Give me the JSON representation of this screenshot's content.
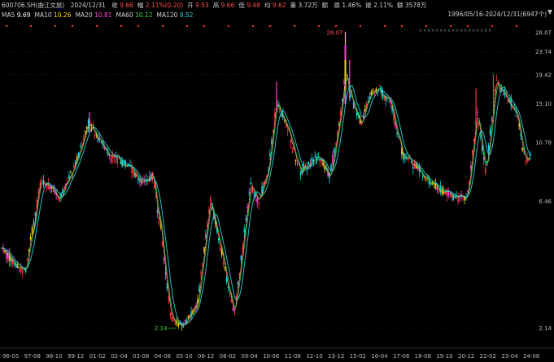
{
  "header": {
    "code_name": "600706.SH(曲江文旅)",
    "date": "2024/12/31",
    "fields": [
      {
        "label": "收",
        "value": "9.66",
        "color": "#ff4d4d"
      },
      {
        "label": "幅",
        "value": "2.11%(0.20)",
        "color": "#ff4d4d"
      },
      {
        "label": "开",
        "value": "9.53",
        "color": "#ff4d4d"
      },
      {
        "label": "高",
        "value": "9.66",
        "color": "#ff4d4d"
      },
      {
        "label": "低",
        "value": "9.48",
        "color": "#ff4d4d"
      },
      {
        "label": "均",
        "value": "9.62",
        "color": "#ff4d4d"
      },
      {
        "label": "量",
        "value": "3.72万",
        "color": "#cfcfcf"
      },
      {
        "label": "额",
        "value": "",
        "color": "#cfcfcf"
      },
      {
        "label": "换",
        "value": "1.46%",
        "color": "#cfcfcf"
      },
      {
        "label": "振",
        "value": "2.11%",
        "color": "#cfcfcf"
      },
      {
        "label": "额",
        "value": "3578万",
        "color": "#cfcfcf"
      }
    ]
  },
  "ma_legend": [
    {
      "label": "MA5",
      "value": "9.69",
      "color": "#ffffff"
    },
    {
      "label": "MA10",
      "value": "10.26",
      "color": "#ffd400"
    },
    {
      "label": "MA20",
      "value": "10.81",
      "color": "#ff44cc"
    },
    {
      "label": "MA60",
      "value": "10.12",
      "color": "#33dd33"
    },
    {
      "label": "MA120",
      "value": "8.52",
      "color": "#33ccdd"
    }
  ],
  "range_text": "1996/05/16-2024/12/31(6947个)",
  "colors": {
    "up": "#ff3333",
    "down": "#00dddd",
    "grid": "#444444",
    "axis_text": "#bbbbbb",
    "yellow": "#ffd400",
    "magenta": "#ff44cc"
  },
  "chart_data": {
    "type": "candlestick",
    "title": "",
    "xlabel": "",
    "ylabel": "",
    "y_scale": "log",
    "ylim": [
      1.9,
      30.0
    ],
    "y_ticks": [
      28.07,
      23.74,
      19.42,
      15.1,
      10.78,
      6.46,
      2.14
    ],
    "y_tick_labels": [
      "28.07",
      "23.74",
      "19.42",
      "15.10",
      "10.78",
      "6.46",
      "2.14"
    ],
    "x_tick_labels": [
      "96-05",
      "97-08",
      "98-10",
      "99-12",
      "01-02",
      "02-04",
      "03-06",
      "04-08",
      "05-10",
      "06-12",
      "08-02",
      "09-04",
      "10-06",
      "11-08",
      "12-10",
      "13-12",
      "15-02",
      "16-04",
      "17-06",
      "18-08",
      "19-10",
      "20-12",
      "22-02",
      "23-04",
      "24-06"
    ],
    "annotations": [
      {
        "text": "28.07",
        "type": "max",
        "value": 28.07
      },
      {
        "text": "2.14",
        "type": "min",
        "value": 2.14
      }
    ],
    "price_path": [
      {
        "t": 0.0,
        "v": 4.2
      },
      {
        "t": 0.02,
        "v": 3.8
      },
      {
        "t": 0.045,
        "v": 3.5
      },
      {
        "t": 0.075,
        "v": 7.8
      },
      {
        "t": 0.11,
        "v": 6.6
      },
      {
        "t": 0.14,
        "v": 9.0
      },
      {
        "t": 0.165,
        "v": 12.8
      },
      {
        "t": 0.185,
        "v": 11.0
      },
      {
        "t": 0.205,
        "v": 9.5
      },
      {
        "t": 0.235,
        "v": 9.0
      },
      {
        "t": 0.265,
        "v": 7.6
      },
      {
        "t": 0.285,
        "v": 8.1
      },
      {
        "t": 0.3,
        "v": 5.2
      },
      {
        "t": 0.32,
        "v": 2.3
      },
      {
        "t": 0.345,
        "v": 2.2
      },
      {
        "t": 0.37,
        "v": 2.6
      },
      {
        "t": 0.395,
        "v": 6.6
      },
      {
        "t": 0.42,
        "v": 3.8
      },
      {
        "t": 0.44,
        "v": 2.4
      },
      {
        "t": 0.47,
        "v": 7.5
      },
      {
        "t": 0.485,
        "v": 6.4
      },
      {
        "t": 0.505,
        "v": 8.5
      },
      {
        "t": 0.52,
        "v": 15.4
      },
      {
        "t": 0.545,
        "v": 11.3
      },
      {
        "t": 0.565,
        "v": 8.3
      },
      {
        "t": 0.6,
        "v": 9.5
      },
      {
        "t": 0.62,
        "v": 8.0
      },
      {
        "t": 0.64,
        "v": 13.0
      },
      {
        "t": 0.65,
        "v": 20.0
      },
      {
        "t": 0.66,
        "v": 16.0
      },
      {
        "t": 0.68,
        "v": 13.0
      },
      {
        "t": 0.7,
        "v": 16.5
      },
      {
        "t": 0.715,
        "v": 17.0
      },
      {
        "t": 0.735,
        "v": 15.2
      },
      {
        "t": 0.76,
        "v": 9.5
      },
      {
        "t": 0.79,
        "v": 8.5
      },
      {
        "t": 0.82,
        "v": 7.2
      },
      {
        "t": 0.85,
        "v": 6.8
      },
      {
        "t": 0.88,
        "v": 6.5
      },
      {
        "t": 0.9,
        "v": 14.0
      },
      {
        "t": 0.915,
        "v": 8.2
      },
      {
        "t": 0.935,
        "v": 18.5
      },
      {
        "t": 0.955,
        "v": 16.0
      },
      {
        "t": 0.975,
        "v": 14.0
      },
      {
        "t": 0.99,
        "v": 9.0
      },
      {
        "t": 1.0,
        "v": 9.66
      }
    ],
    "spikes": [
      {
        "t": 0.65,
        "v": 28.07
      },
      {
        "t": 0.658,
        "v": 22.0
      },
      {
        "t": 0.93,
        "v": 19.42
      },
      {
        "t": 0.52,
        "v": 18.2
      },
      {
        "t": 0.897,
        "v": 17.2
      },
      {
        "t": 0.166,
        "v": 14.0
      }
    ]
  }
}
